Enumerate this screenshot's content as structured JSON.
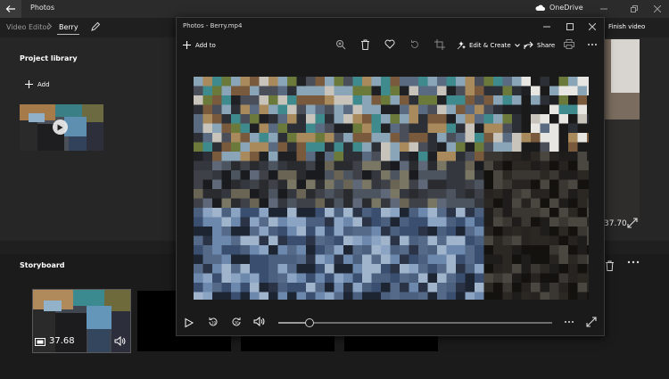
{
  "app": {
    "title": "Photos",
    "onedrive_label": "OneDrive"
  },
  "editor": {
    "breadcrumb_root": "Video Editor",
    "breadcrumb_sep": ">",
    "project_name": "Berry",
    "finish_label": "Finish video"
  },
  "library": {
    "title": "Project library",
    "add_label": "Add"
  },
  "preview": {
    "time": "37.70"
  },
  "storyboard": {
    "title": "Storyboard",
    "clips": [
      {
        "duration": "37.68"
      }
    ]
  },
  "viewer": {
    "title": "Photos - Berry.mp4",
    "toolbar": {
      "add_to_label": "Add to",
      "edit_create_label": "Edit & Create",
      "share_label": "Share"
    },
    "playback": {
      "progress": 0.115
    }
  },
  "colors": {
    "background": "#1f1f1f",
    "panel": "#262626",
    "viewer": "#1a1a1a",
    "text": "#ffffff"
  }
}
